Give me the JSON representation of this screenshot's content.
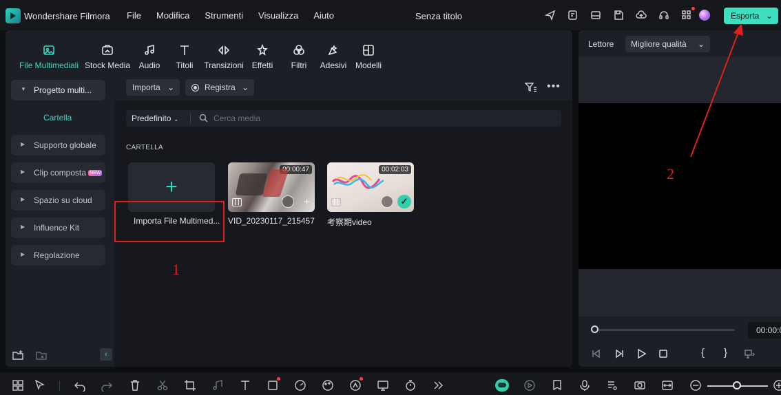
{
  "app": {
    "name": "Wondershare Filmora",
    "doc_title": "Senza titolo"
  },
  "menu": [
    "File",
    "Modifica",
    "Strumenti",
    "Visualizza",
    "Aiuto"
  ],
  "export_label": "Esporta",
  "tabs": [
    {
      "label": "File Multimediali",
      "icon": "media-icon",
      "active": true
    },
    {
      "label": "Stock Media",
      "icon": "stock-icon"
    },
    {
      "label": "Audio",
      "icon": "music-icon"
    },
    {
      "label": "Titoli",
      "icon": "title-icon"
    },
    {
      "label": "Transizioni",
      "icon": "transition-icon"
    },
    {
      "label": "Effetti",
      "icon": "effects-icon"
    },
    {
      "label": "Filtri",
      "icon": "filter-icon"
    },
    {
      "label": "Adesivi",
      "icon": "sticker-icon"
    },
    {
      "label": "Modelli",
      "icon": "template-icon"
    }
  ],
  "sidebar": {
    "project": "Progetto multi...",
    "folder": "Cartella",
    "items": [
      "Supporto globale",
      "Clip composta",
      "Spazio su cloud",
      "Influence Kit",
      "Regolazione"
    ],
    "new_badge": "NEW"
  },
  "media_toolbar": {
    "import": "Importa",
    "record": "Registra"
  },
  "search": {
    "sort": "Predefinito",
    "placeholder": "Cerca media"
  },
  "section_label": "CARTELLA",
  "media": [
    {
      "name": "Importa File Multimed..."
    },
    {
      "name": "VID_20230117_215457",
      "duration": "00:00:47"
    },
    {
      "name": "考察期video",
      "duration": "00:02:03"
    }
  ],
  "annotations": {
    "one": "1",
    "two": "2"
  },
  "player": {
    "label": "Lettore",
    "quality": "Migliore qualità",
    "timecode": "00:00:0",
    "progress": 0
  },
  "colors": {
    "accent": "#3fd6c1",
    "export_bg": "#3ce0c0",
    "annotation": "#e0201e"
  }
}
